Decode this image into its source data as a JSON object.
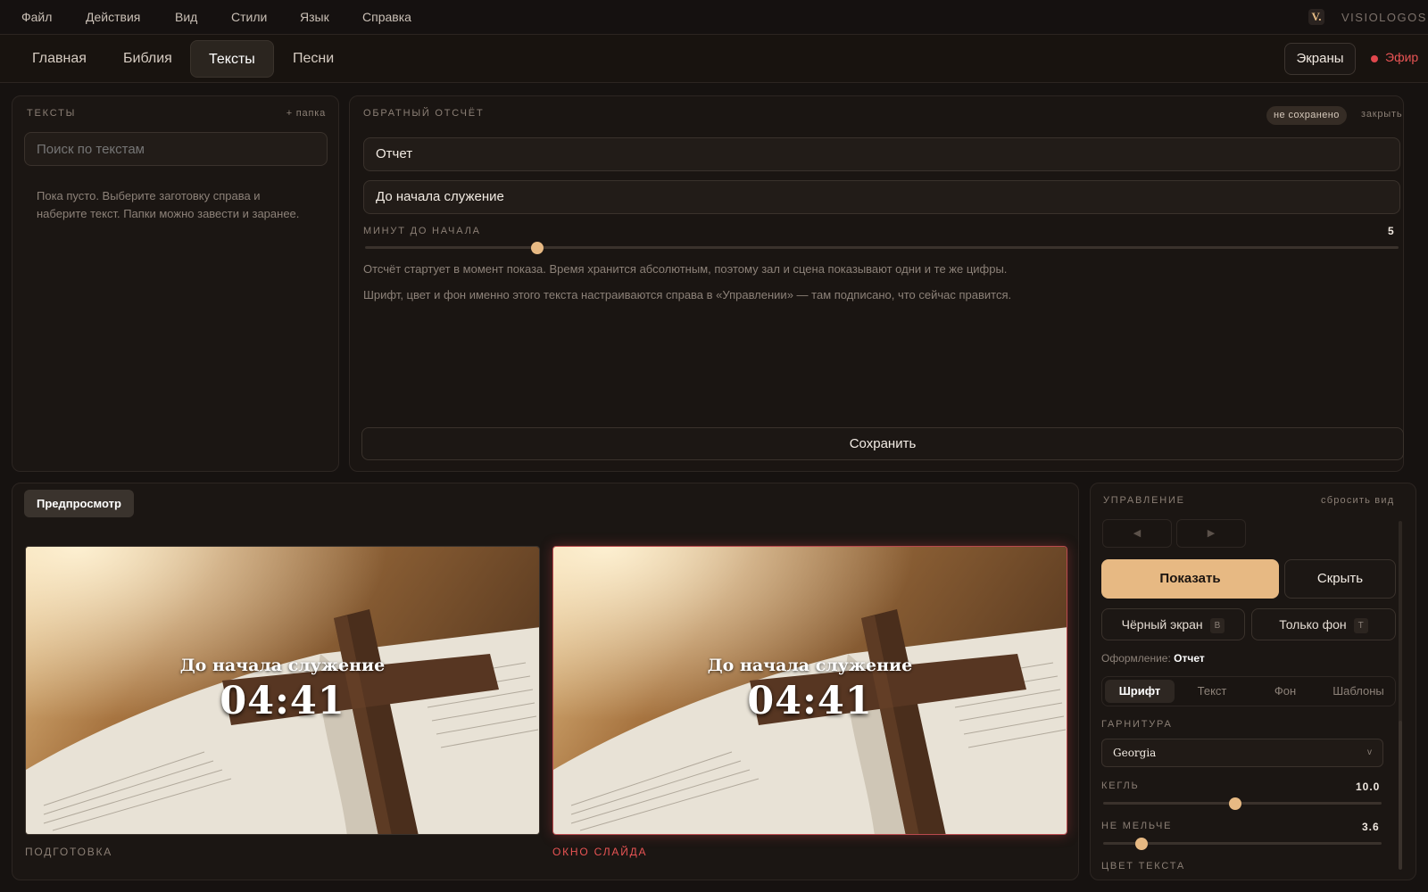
{
  "menu": {
    "items": [
      "Файл",
      "Действия",
      "Вид",
      "Стили",
      "Язык",
      "Справка"
    ]
  },
  "brand": {
    "mark": "V.",
    "name": "VISIOLOGOS"
  },
  "nav": {
    "tabs": [
      "Главная",
      "Библия",
      "Тексты",
      "Песни"
    ],
    "active_tab": "Тексты",
    "screens_label": "Экраны",
    "live_label": "Эфир"
  },
  "texts_panel": {
    "title": "ТЕКСТЫ",
    "add_folder": "+ папка",
    "search_placeholder": "Поиск по текстам",
    "empty_message": "Пока пусто. Выберите заготовку справа и наберите текст. Папки можно завести и заранее."
  },
  "editor": {
    "title": "ОБРАТНЫЙ ОТСЧЁТ",
    "status_badge": "не сохранено",
    "close_label": "закрыть",
    "name_value": "Отчет",
    "caption_value": "До начала служение",
    "minutes_label": "МИНУТ ДО НАЧАЛА",
    "minutes_value": "5",
    "minutes_slider": {
      "min": 0,
      "max": 30,
      "value": 5
    },
    "hint_1": "Отсчёт стартует в момент показа. Время хранится абсолютным, поэтому зал и сцена показывают одни и те же цифры.",
    "hint_2": "Шрифт, цвет и фон именно этого текста настраиваются справа в «Управлении» — там подписано, что сейчас правится.",
    "save_label": "Сохранить"
  },
  "preview": {
    "tab_label": "Предпросмотр",
    "slide_title": "До начала служение",
    "slide_time": "04:41",
    "left_caption": "ПОДГОТОВКА",
    "right_caption": "ОКНО СЛАЙДА"
  },
  "control": {
    "title": "УПРАВЛЕНИЕ",
    "reset_label": "сбросить вид",
    "prev_icon": "◀",
    "next_icon": "▶",
    "show_label": "Показать",
    "hide_label": "Скрыть",
    "black_screen_label": "Чёрный экран",
    "black_screen_key": "B",
    "bg_only_label": "Только фон",
    "bg_only_key": "T",
    "styling_prefix": "Оформление:",
    "styling_target": "Отчет",
    "tabs": [
      "Шрифт",
      "Текст",
      "Фон",
      "Шаблоны"
    ],
    "active_tab": "Шрифт",
    "font_family_label": "ГАРНИТУРА",
    "font_family_value": "Georgia",
    "font_size_label": "КЕГЛЬ",
    "font_size_value": "10.0",
    "font_size_slider": {
      "min": 1,
      "max": 20,
      "value": 10.0
    },
    "min_size_label": "НЕ МЕЛЬЧЕ",
    "min_size_value": "3.6",
    "min_size_slider": {
      "min": 1,
      "max": 20,
      "value": 3.6
    },
    "text_color_label": "ЦВЕТ ТЕКСТА"
  },
  "colors": {
    "accent": "#e7b983",
    "live": "#e85454",
    "background": "#161210"
  }
}
